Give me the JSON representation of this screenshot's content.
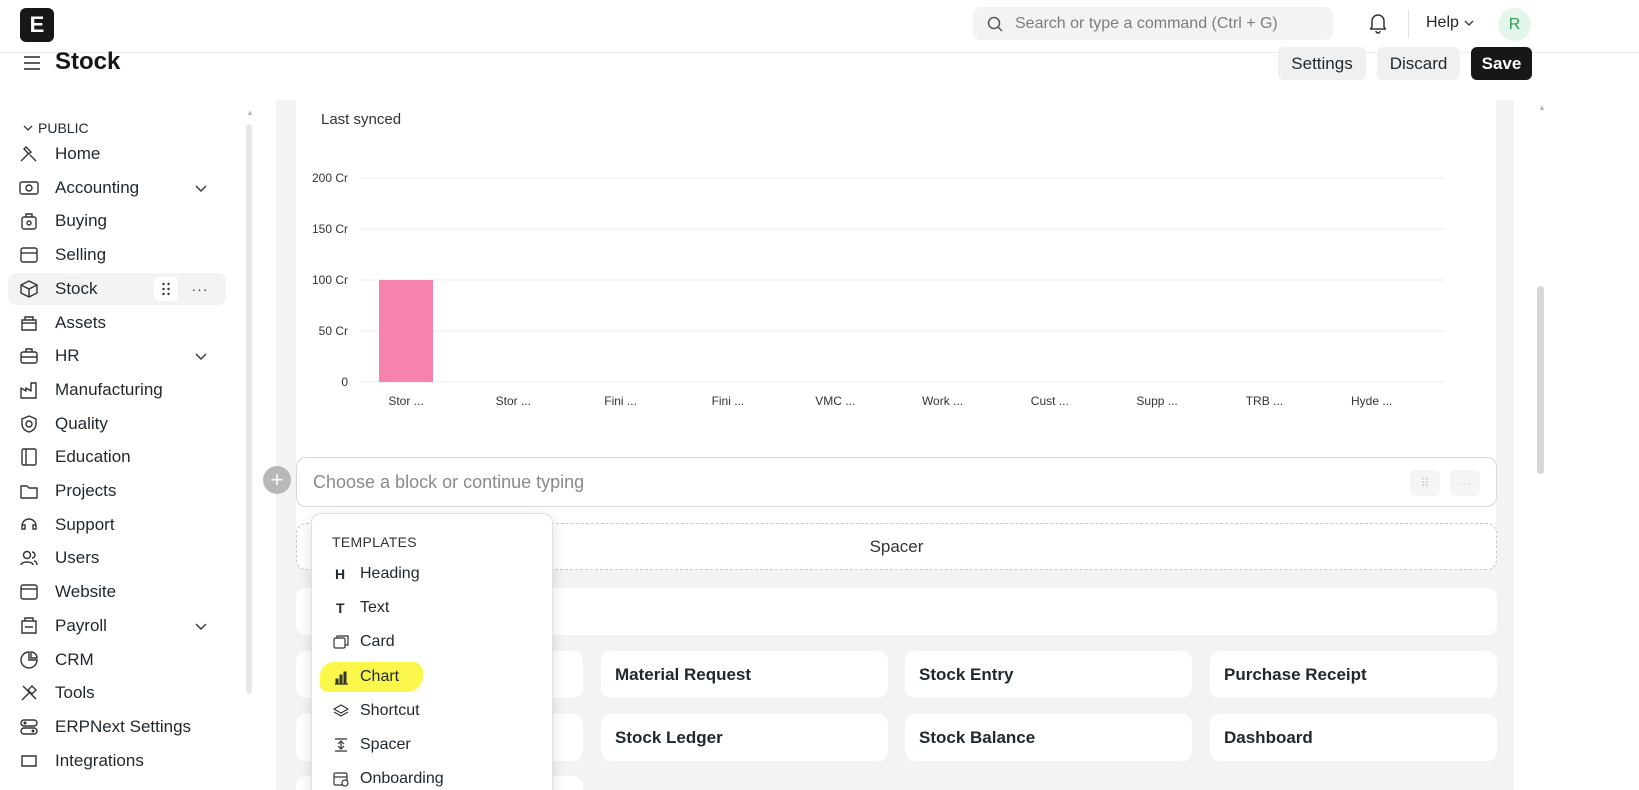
{
  "navbar": {
    "logo_letter": "E",
    "search_placeholder": "Search or type a command (Ctrl + G)",
    "help_label": "Help",
    "avatar_initial": "R"
  },
  "page": {
    "title": "Stock",
    "settings_label": "Settings",
    "discard_label": "Discard",
    "save_label": "Save"
  },
  "sidebar": {
    "section": "PUBLIC",
    "items": [
      {
        "label": "Home",
        "icon": "home-icon"
      },
      {
        "label": "Accounting",
        "icon": "accounting-icon",
        "expandable": true
      },
      {
        "label": "Buying",
        "icon": "buying-icon"
      },
      {
        "label": "Selling",
        "icon": "selling-icon"
      },
      {
        "label": "Stock",
        "icon": "stock-icon",
        "active": true
      },
      {
        "label": "Assets",
        "icon": "assets-icon"
      },
      {
        "label": "HR",
        "icon": "hr-icon",
        "expandable": true
      },
      {
        "label": "Manufacturing",
        "icon": "manufacturing-icon"
      },
      {
        "label": "Quality",
        "icon": "quality-icon"
      },
      {
        "label": "Education",
        "icon": "education-icon"
      },
      {
        "label": "Projects",
        "icon": "projects-icon"
      },
      {
        "label": "Support",
        "icon": "support-icon"
      },
      {
        "label": "Users",
        "icon": "users-icon"
      },
      {
        "label": "Website",
        "icon": "website-icon"
      },
      {
        "label": "Payroll",
        "icon": "payroll-icon",
        "expandable": true
      },
      {
        "label": "CRM",
        "icon": "crm-icon"
      },
      {
        "label": "Tools",
        "icon": "tools-icon"
      },
      {
        "label": "ERPNext Settings",
        "icon": "settings-icon"
      },
      {
        "label": "Integrations",
        "icon": "integrations-icon"
      }
    ]
  },
  "chart_card": {
    "last_synced": "Last synced"
  },
  "chart_data": {
    "type": "bar",
    "categories": [
      "Stor ...",
      "Stor ...",
      "Fini ...",
      "Fini ...",
      "VMC ...",
      "Work ...",
      "Cust ...",
      "Supp ...",
      "TRB ...",
      "Hyde ..."
    ],
    "values": [
      100,
      0,
      0,
      0,
      0,
      0,
      0,
      0,
      0,
      0
    ],
    "y_ticks": [
      0,
      50,
      100,
      150,
      200
    ],
    "y_tick_labels": [
      "0",
      "50 Cr",
      "100 Cr",
      "150 Cr",
      "200 Cr"
    ],
    "ylim": [
      0,
      200
    ],
    "bar_color": "#f683ae",
    "grid": true
  },
  "editor": {
    "block_placeholder": "Choose a block or continue typing",
    "spacer_label": "Spacer"
  },
  "shortcuts": [
    {
      "label": "Material Request"
    },
    {
      "label": "Stock Entry"
    },
    {
      "label": "Purchase Receipt"
    },
    {
      "label": "Stock Ledger"
    },
    {
      "label": "Stock Balance"
    },
    {
      "label": "Dashboard"
    }
  ],
  "dropdown": {
    "heading": "TEMPLATES",
    "items": [
      {
        "label": "Heading",
        "icon": "heading-icon"
      },
      {
        "label": "Text",
        "icon": "text-icon"
      },
      {
        "label": "Card",
        "icon": "card-icon"
      },
      {
        "label": "Chart",
        "icon": "chart-icon",
        "highlighted": true
      },
      {
        "label": "Shortcut",
        "icon": "shortcut-icon"
      },
      {
        "label": "Spacer",
        "icon": "spacer-icon"
      },
      {
        "label": "Onboarding",
        "icon": "onboarding-icon"
      }
    ],
    "highlight_color": "#fbf64a"
  }
}
